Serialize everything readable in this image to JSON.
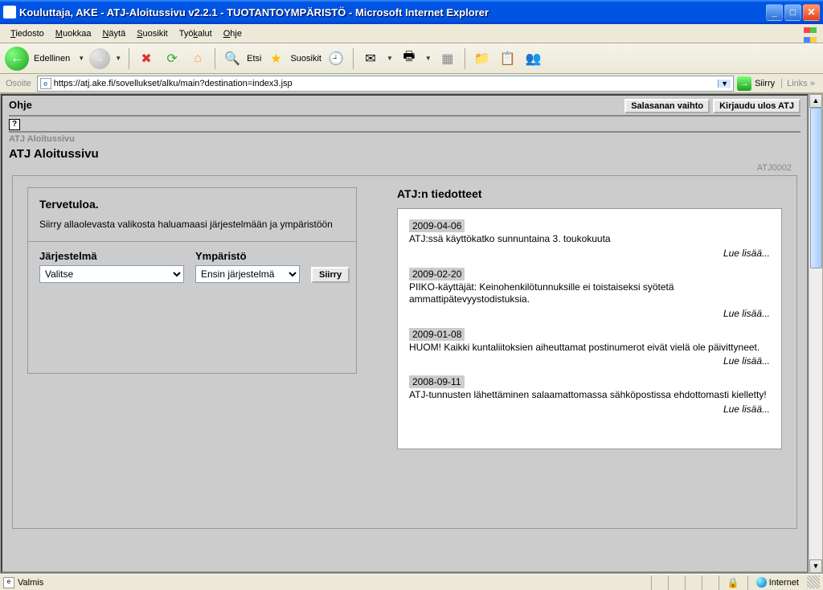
{
  "window": {
    "title": "Kouluttaja, AKE - ATJ-Aloitussivu v2.2.1 - TUOTANTOYMPÄRISTÖ - Microsoft Internet Explorer"
  },
  "menu": {
    "file": "Tiedosto",
    "edit": "Muokkaa",
    "view": "Näytä",
    "favorites": "Suosikit",
    "tools": "Työkalut",
    "help": "Ohje"
  },
  "toolbar": {
    "back": "Edellinen",
    "search": "Etsi",
    "favorites": "Suosikit"
  },
  "address": {
    "label": "Osoite",
    "url": "https://atj.ake.fi/sovellukset/alku/main?destination=index3.jsp",
    "go": "Siirry",
    "links": "Links"
  },
  "page": {
    "ohje": "Ohje",
    "btn_password": "Salasanan vaihto",
    "btn_logout": "Kirjaudu ulos ATJ",
    "breadcrumb": "ATJ Aloitussivu",
    "title": "ATJ Aloitussivu",
    "code": "ATJ0002"
  },
  "welcome": {
    "title": "Tervetuloa.",
    "text": "Siirry allaolevasta valikosta haluamaasi järjestelmään ja ympäristöön",
    "label_system": "Järjestelmä",
    "label_env": "Ympäristö",
    "select_system": "Valitse",
    "select_env": "Ensin järjestelmä",
    "go": "Siirry"
  },
  "notices": {
    "title": "ATJ:n tiedotteet",
    "more": "Lue lisää...",
    "items": [
      {
        "date": "2009-04-06",
        "body": "ATJ:ssä käyttökatko sunnuntaina 3. toukokuuta"
      },
      {
        "date": "2009-02-20",
        "body": "PIIKO-käyttäjät: Keinohenkilötunnuksille ei toistaiseksi syötetä ammattipätevyystodistuksia."
      },
      {
        "date": "2009-01-08",
        "body": "HUOM! Kaikki kuntaliitoksien aiheuttamat postinumerot eivät vielä ole päivittyneet."
      },
      {
        "date": "2008-09-11",
        "body": "ATJ-tunnusten lähettäminen salaamattomassa sähköpostissa ehdottomasti kielletty!"
      }
    ]
  },
  "status": {
    "ready": "Valmis",
    "zone": "Internet"
  }
}
